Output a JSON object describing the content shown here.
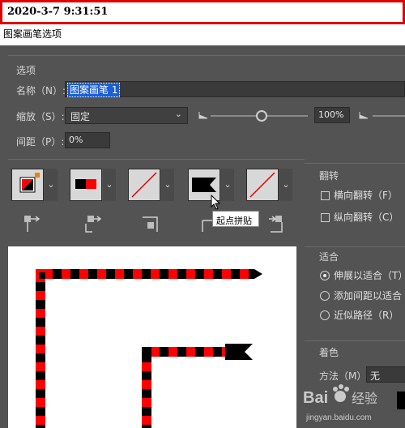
{
  "timestamp": "2020-3-7 9:31:51",
  "window_title": "图案画笔选项",
  "options": {
    "section": "选项",
    "name_label": "名称（N）:",
    "name_value": "图案画笔 1",
    "scale_label": "缩放（S）:",
    "scale_value": "固定",
    "scale_percent": "100%",
    "spacing_label": "间距（P）:",
    "spacing_value": "0%"
  },
  "tiles": [
    "边线拼贴",
    "外角拼贴",
    "内角拼贴",
    "起点拼贴",
    "终点拼贴"
  ],
  "tooltip": "起点拼贴",
  "flip": {
    "section": "翻转",
    "horizontal": "横向翻转（F）",
    "vertical": "纵向翻转（C）"
  },
  "fit": {
    "section": "适合",
    "stretch": "伸展以适合（T）",
    "add_space": "添加间距以适合",
    "approx_path": "近似路径（R）",
    "selected": "stretch"
  },
  "colorize": {
    "section": "着色",
    "method_label": "方法（M）:",
    "method_value": "无"
  },
  "watermark": {
    "text": "Bai 经验",
    "url": "jingyan.baidu.com"
  },
  "colors": {
    "dialog_bg": "#535353",
    "pattern_red": "#ff0000",
    "pattern_black": "#000000",
    "highlight": "#1a5fd6",
    "frame_red": "#e00000"
  }
}
